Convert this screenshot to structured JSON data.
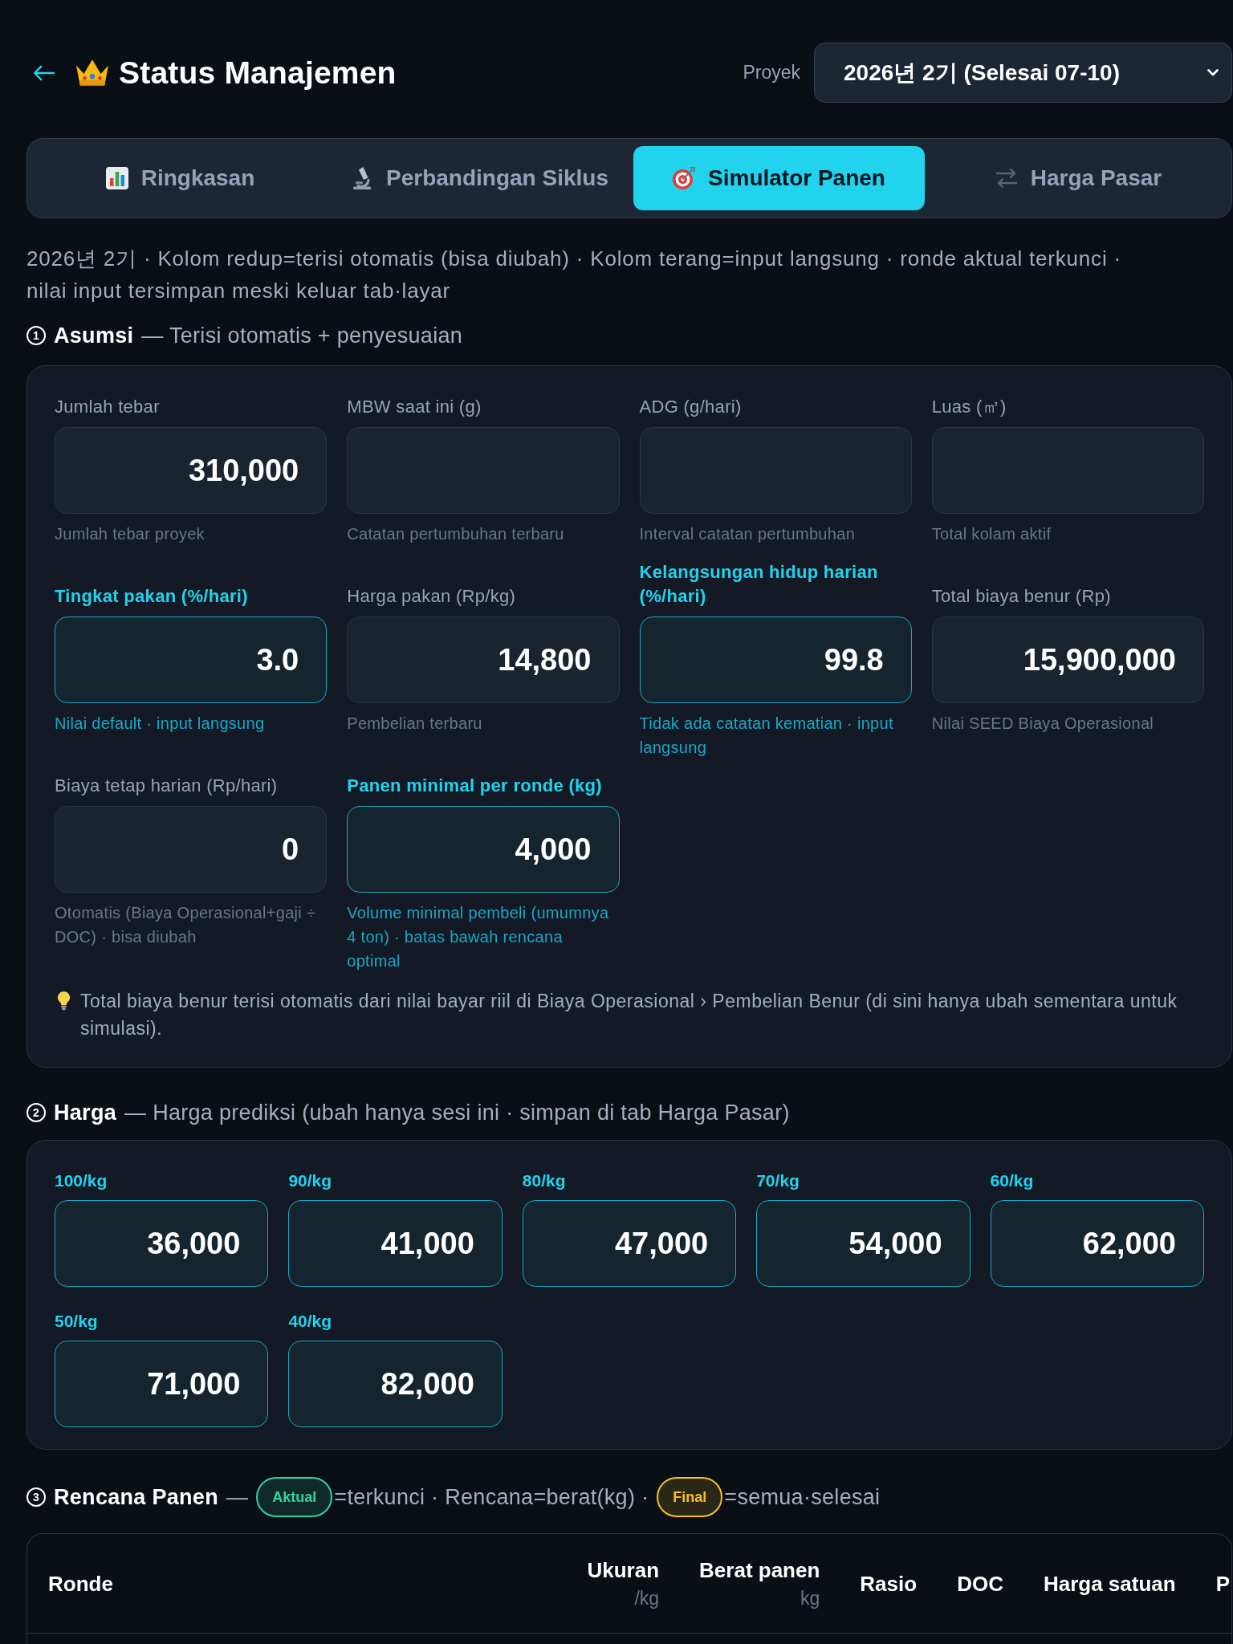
{
  "header": {
    "title": "Status Manajemen",
    "project_label": "Proyek",
    "project_select": "2026년 2기 (Selesai 07-10)"
  },
  "tabs": [
    {
      "label": "Ringkasan",
      "selected": false
    },
    {
      "label": "Perbandingan Siklus",
      "selected": false
    },
    {
      "label": "Simulator Panen",
      "selected": true
    },
    {
      "label": "Harga Pasar",
      "selected": false
    }
  ],
  "description": "2026년 2기 · Kolom redup=terisi otomatis (bisa diubah) · Kolom terang=input langsung · ronde aktual terkunci · nilai input tersimpan meski keluar tab·layar",
  "assumptions": {
    "number": "1",
    "title": "Asumsi",
    "subtitle": "— Terisi otomatis + penyesuaian",
    "fields": [
      {
        "label": "Jumlah tebar",
        "kind": "auto",
        "value": "310,000",
        "hint": "Jumlah tebar proyek"
      },
      {
        "label": "MBW saat ini (g)",
        "kind": "auto",
        "hint": "Catatan pertumbuhan terbaru"
      },
      {
        "label": "ADG (g/hari)",
        "kind": "auto",
        "hint": "Interval catatan pertumbuhan"
      },
      {
        "label": "Luas (㎡)",
        "kind": "auto",
        "hint": "Total kolam aktif"
      },
      {
        "label": "Tingkat pakan (%/hari)",
        "kind": "direct",
        "value": "3.0",
        "hint": "Nilai default · input langsung"
      },
      {
        "label": "Harga pakan (Rp/kg)",
        "kind": "auto",
        "value": "14,800",
        "hint": "Pembelian terbaru"
      },
      {
        "label": "Kelangsungan hidup harian (%/hari)",
        "kind": "direct",
        "value": "99.8",
        "hint": "Tidak ada catatan kematian · input langsung"
      },
      {
        "label": "Total biaya benur (Rp)",
        "kind": "auto",
        "value": "15,900,000",
        "hint": "Nilai SEED Biaya Operasional"
      },
      {
        "label": "Biaya tetap harian (Rp/hari)",
        "kind": "auto",
        "value": "0",
        "hint": "Otomatis (Biaya Operasional+gaji ÷ DOC) · bisa diubah"
      },
      {
        "label": "Panen minimal per ronde (kg)",
        "kind": "direct",
        "value": "4,000",
        "hint": "Volume minimal pembeli (umumnya 4 ton) · batas bawah rencana optimal"
      }
    ],
    "note": "Total biaya benur terisi otomatis dari nilai bayar riil di Biaya Operasional › Pembelian Benur (di sini hanya ubah sementara untuk simulasi)."
  },
  "prices": {
    "number": "2",
    "title": "Harga",
    "subtitle": "— Harga prediksi (ubah hanya sesi ini · simpan di tab Harga Pasar)",
    "fields": [
      {
        "label": "100/kg",
        "value": "36,000"
      },
      {
        "label": "90/kg",
        "value": "41,000"
      },
      {
        "label": "80/kg",
        "value": "47,000"
      },
      {
        "label": "70/kg",
        "value": "54,000"
      },
      {
        "label": "60/kg",
        "value": "62,000"
      },
      {
        "label": "50/kg",
        "value": "71,000"
      },
      {
        "label": "40/kg",
        "value": "82,000"
      }
    ]
  },
  "harvest_plan": {
    "number": "3",
    "title": "Rencana Panen",
    "legend": [
      {
        "kind": "text",
        "text": "—"
      },
      {
        "kind": "tag",
        "text": "Aktual",
        "color": "#34d399"
      },
      {
        "kind": "text",
        "text": "=terkunci · Rencana=berat(kg) ·"
      },
      {
        "kind": "tag",
        "text": "Final",
        "color": "#fbbf24"
      },
      {
        "kind": "text",
        "text": "=semua·selesai"
      }
    ],
    "table": {
      "columns": [
        {
          "label": "Ronde"
        },
        {
          "label": "Ukuran",
          "unit": "/kg"
        },
        {
          "label": "Berat panen",
          "unit": "kg"
        },
        {
          "label": "Rasio"
        },
        {
          "label": "DOC"
        },
        {
          "label": "Harga satuan"
        },
        {
          "label": "P"
        }
      ]
    }
  }
}
